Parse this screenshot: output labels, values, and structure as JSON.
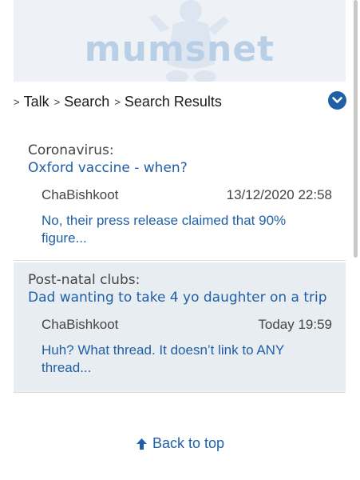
{
  "banner": {
    "logo_text": "mumsnet"
  },
  "breadcrumb": [
    "Talk",
    "Search",
    "Search Results"
  ],
  "results": [
    {
      "topic": "Coronavirus:",
      "thread": "Oxford vaccine - when?",
      "author": "ChaBishkoot",
      "date": "13/12/2020 22:58",
      "snippet_line1": "No, their press release claimed that 90%",
      "snippet_line2": "figure..."
    },
    {
      "topic": "Post-natal clubs:",
      "thread": "Dad wanting to take 4 yo daughter on a trip",
      "author": "ChaBishkoot",
      "date": "Today 19:59",
      "snippet_line1": "Huh? What thread. It doesn’t link to ANY",
      "snippet_line2": "thread..."
    }
  ],
  "footer": {
    "back_to_top": "Back to top"
  },
  "colors": {
    "link": "#1f5fa6",
    "alt_row": "#e8edf2",
    "banner_bg": "#eef1f5"
  }
}
